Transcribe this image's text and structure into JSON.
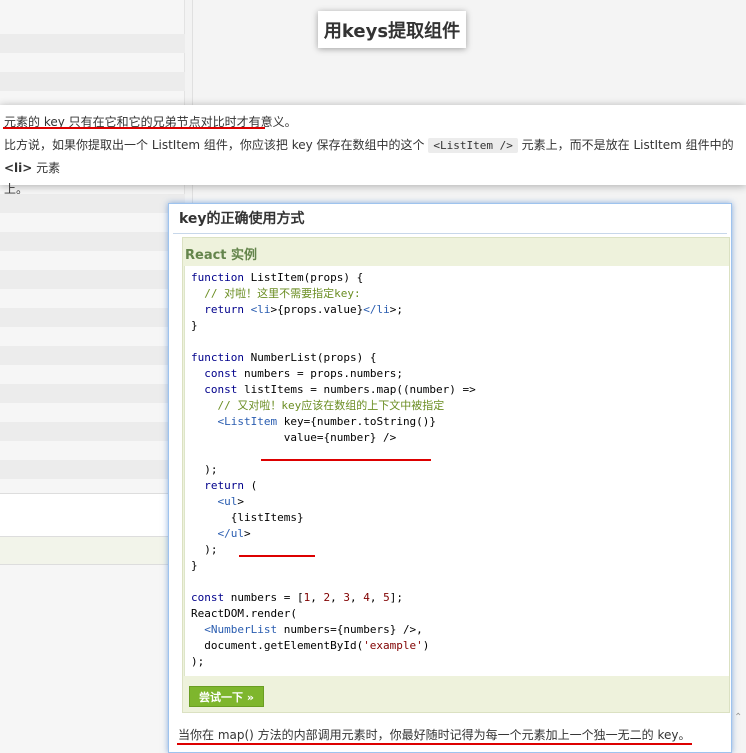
{
  "page": {
    "title": "用keys提取组件"
  },
  "intro": {
    "line1": "元素的 key 只有在它和它的兄弟节点对比时才有意义。",
    "line2_a": "比方说，如果你提取出一个 ListItem 组件，你应该把 key 保存在数组中的这个 ",
    "line2_code": "<ListItem />",
    "line2_b": " 元素上，而不是放在 ListItem 组件中的 ",
    "line2_bold": "<li>",
    "line2_c": " 元素",
    "line3": "上。"
  },
  "card": {
    "title": "key的正确使用方式",
    "example_label": "React 实例",
    "try_button": "尝试一下 »",
    "bottom_text": "当你在 map() 方法的内部调用元素时，你最好随时记得为每一个元素加上一个独一无二的 key。"
  },
  "code": [
    "function ListItem(props) {",
    "  // 对啦！这里不需要指定key:",
    "  return <li>{props.value}</li>;",
    "}",
    "",
    "function NumberList(props) {",
    "  const numbers = props.numbers;",
    "  const listItems = numbers.map((number) =>",
    "    // 又对啦！key应该在数组的上下文中被指定",
    "    <ListItem key={number.toString()}",
    "              value={number} />",
    "",
    "  );",
    "  return (",
    "    <ul>",
    "      {listItems}",
    "    </ul>",
    "  );",
    "}",
    "",
    "const numbers = [1, 2, 3, 4, 5];",
    "ReactDOM.render(",
    "  <NumberList numbers={numbers} />,",
    "  document.getElementById('example')",
    ");"
  ],
  "colors": {
    "accent_green": "#7eb62d",
    "label_green": "#64854c",
    "underline_red": "#dd0000",
    "card_border": "#9ec3ee"
  }
}
